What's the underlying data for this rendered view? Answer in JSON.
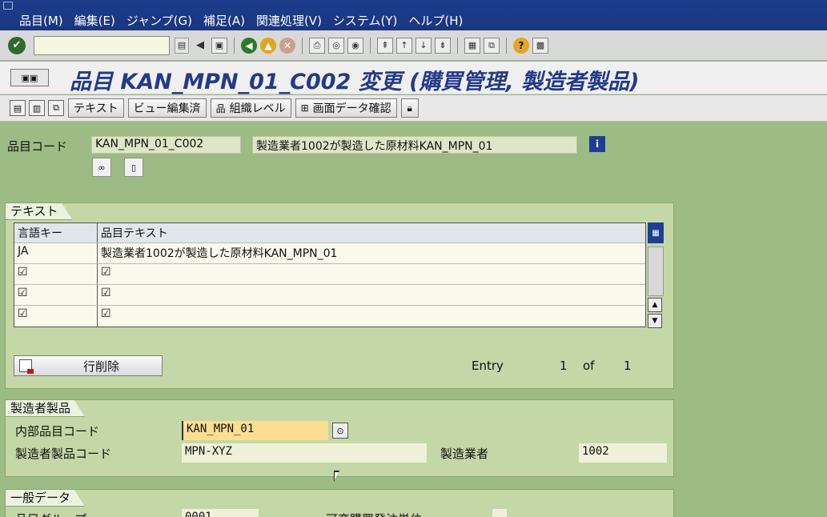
{
  "menubar": {
    "items": [
      "品目(M)",
      "編集(E)",
      "ジャンプ(G)",
      "補足(A)",
      "関連処理(V)",
      "システム(Y)",
      "ヘルプ(H)"
    ]
  },
  "toolbar": {
    "command_value": ""
  },
  "title": {
    "text": "品目 KAN_MPN_01_C002 変更 (購買管理, 製造者製品)"
  },
  "app_toolbar": {
    "buttons": [
      "テキスト",
      "ビュー編集済",
      "組織レベル",
      "画面データ確認"
    ]
  },
  "header": {
    "material_label": "品目コード",
    "material_code": "KAN_MPN_01_C002",
    "material_desc": "製造業者1002が製造した原材料KAN_MPN_01"
  },
  "text_group": {
    "title": "テキスト",
    "columns": [
      "言語キー",
      "品目テキスト"
    ],
    "rows": [
      {
        "lang": "JA",
        "text": "製造業者1002が製造した原材料KAN_MPN_01"
      },
      {
        "lang": "☑",
        "text": "☑"
      },
      {
        "lang": "☑",
        "text": "☑"
      },
      {
        "lang": "☑",
        "text": "☑"
      }
    ],
    "delete_button": "行削除",
    "entry_label": "Entry",
    "entry_current": "1",
    "entry_of": "of",
    "entry_total": "1"
  },
  "mfr_group": {
    "title": "製造者製品",
    "internal_label": "内部品目コード",
    "internal_value": "KAN_MPN_01",
    "mpn_label": "製造者製品コード",
    "mpn_value": "MPN-XYZ",
    "manufacturer_label": "製造業者",
    "manufacturer_value": "1002"
  },
  "general_group": {
    "title": "一般データ",
    "material_group_label": "品目グループ",
    "material_group_value": "0001",
    "variable_unit_label": "可変購買発注単位"
  },
  "colors": {
    "menubar_bg": "#1c3c8c",
    "background": "#9dbb84",
    "group_bg": "#c4d7a6",
    "title_text": "#233a8a",
    "active_field": "#fcde93"
  }
}
